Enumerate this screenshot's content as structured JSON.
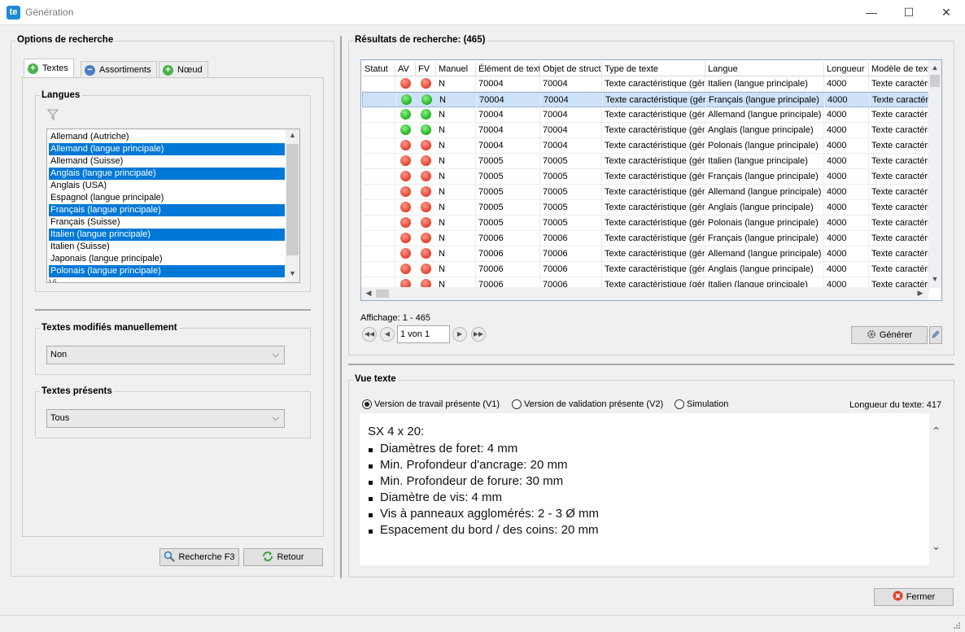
{
  "window": {
    "icon_text": "te",
    "title": "Génération",
    "minimize": "—",
    "maximize": "☐",
    "close": "✕"
  },
  "search_options": {
    "title": "Options de recherche",
    "tabs": [
      {
        "label": "Textes",
        "icon": "plus-icon",
        "active": true
      },
      {
        "label": "Assortiments",
        "icon": "minus-icon",
        "active": false
      },
      {
        "label": "Nœud",
        "icon": "plus-icon",
        "active": false
      }
    ],
    "languages": {
      "title": "Langues",
      "items": [
        {
          "label": "Allemand (Autriche)",
          "selected": false
        },
        {
          "label": "Allemand (langue principale)",
          "selected": true
        },
        {
          "label": "Allemand (Suisse)",
          "selected": false
        },
        {
          "label": "Anglais (langue principale)",
          "selected": true
        },
        {
          "label": "Anglais (USA)",
          "selected": false
        },
        {
          "label": "Espagnol (langue principale)",
          "selected": false
        },
        {
          "label": "Français (langue principale)",
          "selected": true
        },
        {
          "label": "Français (Suisse)",
          "selected": false
        },
        {
          "label": "Italien (langue principale)",
          "selected": true
        },
        {
          "label": "Italien (Suisse)",
          "selected": false
        },
        {
          "label": "Japonais (langue principale)",
          "selected": false
        },
        {
          "label": "Polonais (langue principale)",
          "selected": true
        }
      ]
    },
    "manual": {
      "title": "Textes modifiés manuellement",
      "value": "Non"
    },
    "present": {
      "title": "Textes présents",
      "value": "Tous"
    },
    "search_button": "Recherche F3",
    "back_button": "Retour"
  },
  "results": {
    "title": "Résultats de recherche: (465)",
    "columns": [
      "Statut",
      "AV",
      "FV",
      "Manuel",
      "Élément de texte",
      "Objet de structure",
      "Type de texte",
      "Langue",
      "Longueur",
      "Modèle de texte"
    ],
    "rows": [
      {
        "statut": "",
        "av": "red",
        "fv": "red",
        "manuel": "N",
        "element": "70004",
        "objet": "70004",
        "type": "Texte caractéristique (générique)",
        "langue": "Italien (langue principale)",
        "longueur": "4000",
        "modele": "Texte caractéristique",
        "selected": false
      },
      {
        "statut": "",
        "av": "green",
        "fv": "green",
        "manuel": "N",
        "element": "70004",
        "objet": "70004",
        "type": "Texte caractéristique (générique)",
        "langue": "Français (langue principale)",
        "longueur": "4000",
        "modele": "Texte caractéristique",
        "selected": true
      },
      {
        "statut": "",
        "av": "green",
        "fv": "green",
        "manuel": "N",
        "element": "70004",
        "objet": "70004",
        "type": "Texte caractéristique (générique)",
        "langue": "Allemand (langue principale)",
        "longueur": "4000",
        "modele": "Texte caractéristique",
        "selected": false
      },
      {
        "statut": "",
        "av": "green",
        "fv": "green",
        "manuel": "N",
        "element": "70004",
        "objet": "70004",
        "type": "Texte caractéristique (générique)",
        "langue": "Anglais (langue principale)",
        "longueur": "4000",
        "modele": "Texte caractéristique",
        "selected": false
      },
      {
        "statut": "",
        "av": "red",
        "fv": "red",
        "manuel": "N",
        "element": "70004",
        "objet": "70004",
        "type": "Texte caractéristique (générique)",
        "langue": "Polonais (langue principale)",
        "longueur": "4000",
        "modele": "Texte caractéristique",
        "selected": false
      },
      {
        "statut": "",
        "av": "red",
        "fv": "red",
        "manuel": "N",
        "element": "70005",
        "objet": "70005",
        "type": "Texte caractéristique (générique)",
        "langue": "Italien (langue principale)",
        "longueur": "4000",
        "modele": "Texte caractéristique",
        "selected": false
      },
      {
        "statut": "",
        "av": "red",
        "fv": "red",
        "manuel": "N",
        "element": "70005",
        "objet": "70005",
        "type": "Texte caractéristique (générique)",
        "langue": "Français (langue principale)",
        "longueur": "4000",
        "modele": "Texte caractéristique",
        "selected": false
      },
      {
        "statut": "",
        "av": "red",
        "fv": "red",
        "manuel": "N",
        "element": "70005",
        "objet": "70005",
        "type": "Texte caractéristique (générique)",
        "langue": "Allemand (langue principale)",
        "longueur": "4000",
        "modele": "Texte caractéristique",
        "selected": false
      },
      {
        "statut": "",
        "av": "red",
        "fv": "red",
        "manuel": "N",
        "element": "70005",
        "objet": "70005",
        "type": "Texte caractéristique (générique)",
        "langue": "Anglais (langue principale)",
        "longueur": "4000",
        "modele": "Texte caractéristique",
        "selected": false
      },
      {
        "statut": "",
        "av": "red",
        "fv": "red",
        "manuel": "N",
        "element": "70005",
        "objet": "70005",
        "type": "Texte caractéristique (générique)",
        "langue": "Polonais (langue principale)",
        "longueur": "4000",
        "modele": "Texte caractéristique",
        "selected": false
      },
      {
        "statut": "",
        "av": "red",
        "fv": "red",
        "manuel": "N",
        "element": "70006",
        "objet": "70006",
        "type": "Texte caractéristique (générique)",
        "langue": "Français (langue principale)",
        "longueur": "4000",
        "modele": "Texte caractéristique",
        "selected": false
      },
      {
        "statut": "",
        "av": "red",
        "fv": "red",
        "manuel": "N",
        "element": "70006",
        "objet": "70006",
        "type": "Texte caractéristique (générique)",
        "langue": "Allemand (langue principale)",
        "longueur": "4000",
        "modele": "Texte caractéristique",
        "selected": false
      },
      {
        "statut": "",
        "av": "red",
        "fv": "red",
        "manuel": "N",
        "element": "70006",
        "objet": "70006",
        "type": "Texte caractéristique (générique)",
        "langue": "Anglais (langue principale)",
        "longueur": "4000",
        "modele": "Texte caractéristique",
        "selected": false
      },
      {
        "statut": "",
        "av": "red",
        "fv": "red",
        "manuel": "N",
        "element": "70006",
        "objet": "70006",
        "type": "Texte caractéristique (générique)",
        "langue": "Italien (langue principale)",
        "longueur": "4000",
        "modele": "Texte caractéristique",
        "selected": false
      }
    ],
    "display": "Affichage: 1 - 465",
    "page": "1 von 1",
    "generate_button": "Générer"
  },
  "text_view": {
    "title": "Vue texte",
    "options": [
      {
        "label": "Version de travail présente  (V1)",
        "checked": true
      },
      {
        "label": "Version de validation présente  (V2)",
        "checked": false
      },
      {
        "label": "Simulation",
        "checked": false
      }
    ],
    "length": "Longueur du texte: 417",
    "heading": "SX 4 x 20:",
    "bullets": [
      "Diamètres de foret: 4 mm",
      "Min. Profondeur d'ancrage: 20 mm",
      "Min. Profondeur de forure: 30 mm",
      "Diamètre de vis: 4 mm",
      "Vis à panneaux agglomérés: 2 - 3 Ø mm",
      "Espacement du bord / des coins: 20 mm"
    ]
  },
  "close_button": "Fermer",
  "colors": {
    "selection": "#0078d7",
    "row_selected": "#cde2f7",
    "status_red": "#e0402c",
    "status_green": "#1fb21f"
  }
}
